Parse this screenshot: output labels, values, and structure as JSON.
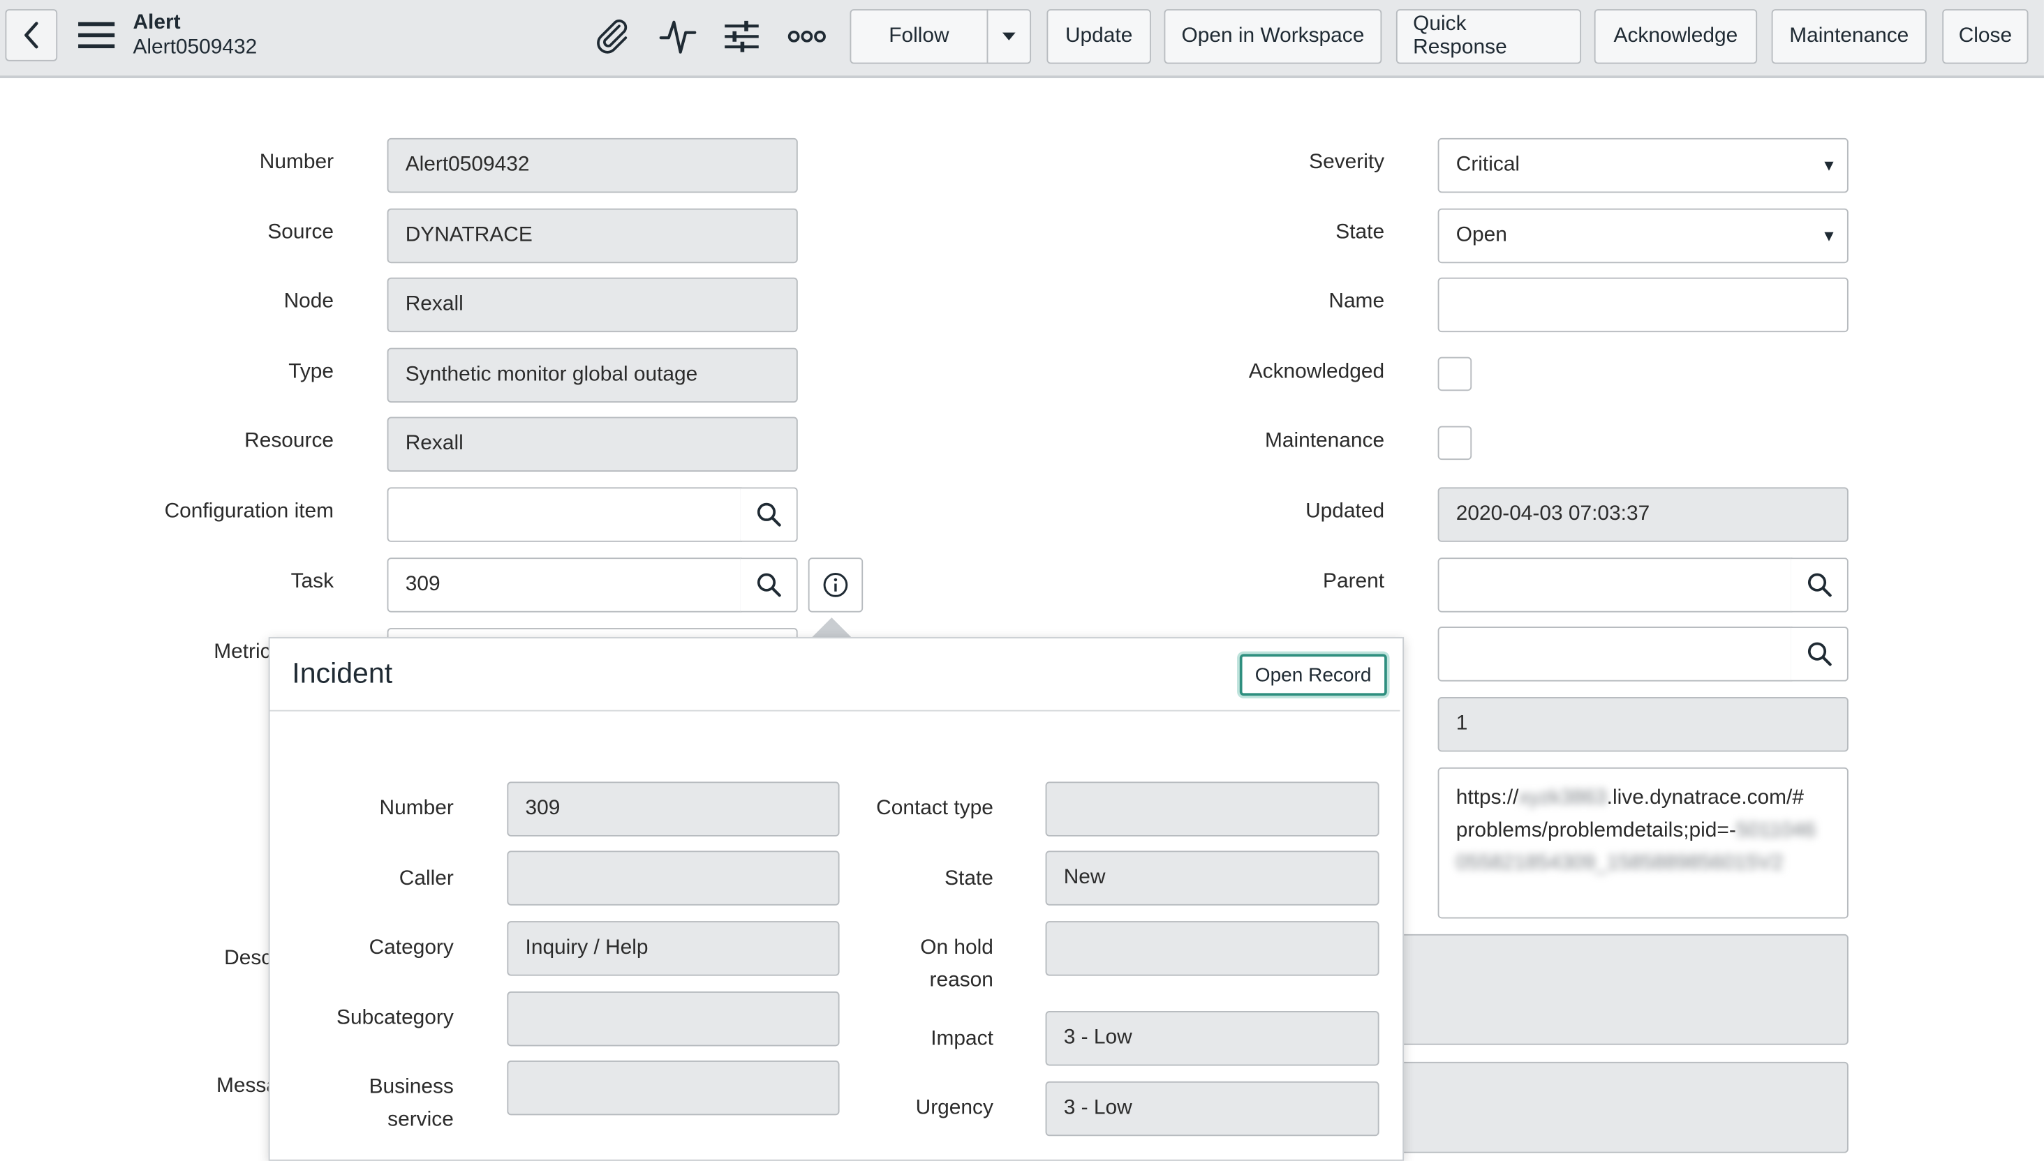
{
  "header": {
    "title": "Alert",
    "subtitle": "Alert0509432",
    "buttons": {
      "follow": "Follow",
      "update": "Update",
      "open_workspace": "Open in Workspace",
      "quick_response": "Quick Response",
      "acknowledge": "Acknowledge",
      "maintenance": "Maintenance",
      "close": "Close"
    },
    "icons": [
      "back-chevron-icon",
      "hamburger-menu-icon",
      "paperclip-icon",
      "activity-pulse-icon",
      "settings-sliders-icon",
      "more-options-icon",
      "caret-down-icon"
    ]
  },
  "form": {
    "left": {
      "number": {
        "label": "Number",
        "value": "Alert0509432"
      },
      "source": {
        "label": "Source",
        "value": "DYNATRACE"
      },
      "node": {
        "label": "Node",
        "value": "Rexall"
      },
      "type": {
        "label": "Type",
        "value": "Synthetic monitor global outage"
      },
      "resource": {
        "label": "Resource",
        "value": "Rexall"
      },
      "config_item": {
        "label": "Configuration item",
        "value": ""
      },
      "task": {
        "label": "Task",
        "value": "309"
      },
      "metric_partial": "Metric",
      "desc_partial": "Desc",
      "message_partial": "Messa"
    },
    "right": {
      "severity": {
        "label": "Severity",
        "value": "Critical"
      },
      "state": {
        "label": "State",
        "value": "Open"
      },
      "name": {
        "label": "Name",
        "value": ""
      },
      "acknowledged": {
        "label": "Acknowledged"
      },
      "maintenance": {
        "label": "Maintenance"
      },
      "updated": {
        "label": "Updated",
        "value": "2020-04-03 07:03:37"
      },
      "parent": {
        "label": "Parent",
        "value": ""
      },
      "count_value": "1",
      "url_line1_prefix": "https://",
      "url_line1_blur": "xyzk3863",
      "url_line1_suffix": ".live.dynatrace.com/#",
      "url_line2_prefix": "problems/problemdetails;pid=-",
      "url_line2_blur": "5011046",
      "url_line3_blur": "055821854309_1585889856015V2"
    }
  },
  "popover": {
    "title": "Incident",
    "open_record": "Open Record",
    "left": {
      "number": {
        "label": "Number",
        "value": "309"
      },
      "caller": {
        "label": "Caller",
        "value": ""
      },
      "category": {
        "label": "Category",
        "value": "Inquiry / Help"
      },
      "subcategory": {
        "label": "Subcategory",
        "value": ""
      },
      "business_service_l1": "Business",
      "business_service_l2": "service"
    },
    "right": {
      "contact_type": {
        "label": "Contact type",
        "value": ""
      },
      "state": {
        "label": "State",
        "value": "New"
      },
      "on_hold_l1": "On hold",
      "on_hold_l2": "reason",
      "impact": {
        "label": "Impact",
        "value": "3 - Low"
      },
      "urgency": {
        "label": "Urgency",
        "value": "3 - Low"
      }
    }
  }
}
